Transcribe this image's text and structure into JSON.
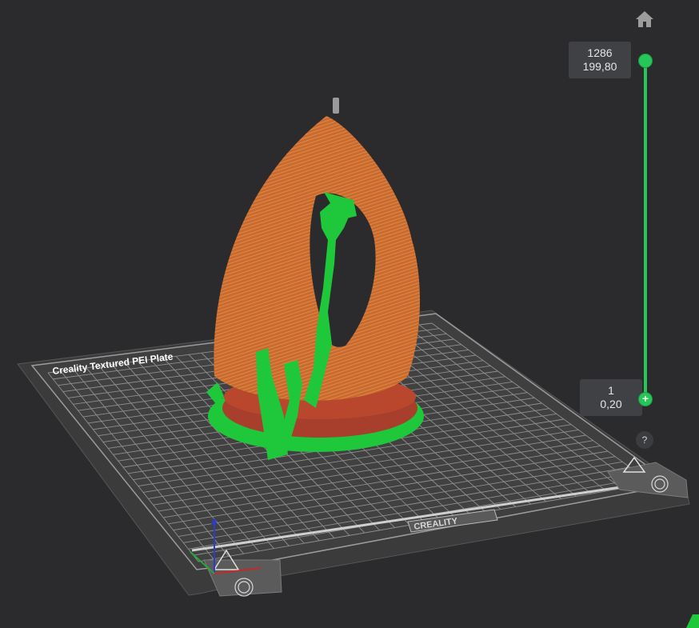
{
  "viewport": {
    "plate_label": "Creality Textured PEI Plate",
    "plate_brand": "CREALITY",
    "corner_marks": [
      "Warning",
      "Warning"
    ]
  },
  "home_button": {
    "icon": "home-icon"
  },
  "layer_slider": {
    "top_layer": "1286",
    "top_height": "199,80",
    "bottom_layer": "1",
    "bottom_height": "0,20",
    "bottom_handle_symbol": "+",
    "accent_color": "#27c658"
  },
  "help_button": {
    "label": "?"
  },
  "colors": {
    "model_wall": "#c8682f",
    "model_support": "#1fc83a",
    "model_base": "#a83e2c",
    "background": "#2b2b2d"
  }
}
